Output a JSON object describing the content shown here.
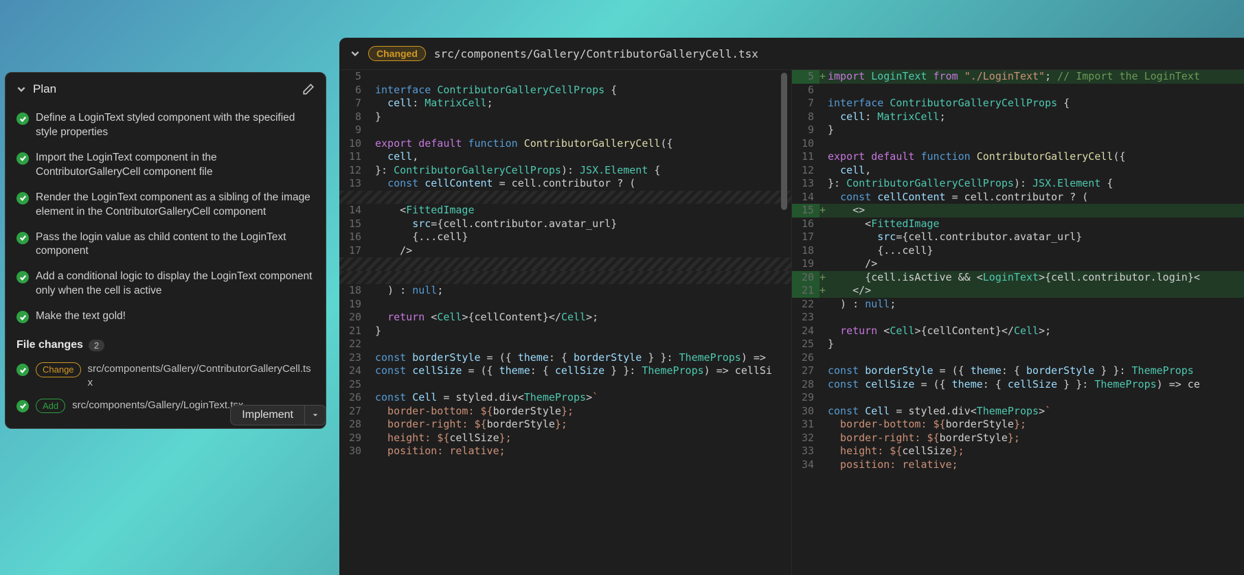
{
  "plan": {
    "title": "Plan",
    "items": [
      "Define a LoginText styled component with the specified style properties",
      "Import the LoginText component in the ContributorGalleryCell component file",
      "Render the LoginText component as a sibling of the image element in the ContributorGalleryCell component",
      "Pass the login value as child content to the LoginText component",
      "Add a conditional logic to display the LoginText component only when the cell is active",
      "Make the text gold!"
    ]
  },
  "file_changes": {
    "label": "File changes",
    "count": "2",
    "items": [
      {
        "badge": "Change",
        "path": "src/components/Gallery/ContributorGalleryCell.tsx"
      },
      {
        "badge": "Add",
        "path": "src/components/Gallery/LoginText.tsx"
      }
    ]
  },
  "implement_label": "Implement",
  "diff": {
    "badge": "Changed",
    "path": "src/components/Gallery/ContributorGalleryCell.tsx",
    "left": [
      {
        "n": "5",
        "t": "empty"
      },
      {
        "n": "6",
        "t": "code",
        "html": "<span class='kw2'>interface</span> <span class='type'>ContributorGalleryCellProps</span> {"
      },
      {
        "n": "7",
        "t": "code",
        "html": "  <span class='prop'>cell</span>: <span class='type'>MatrixCell</span>;"
      },
      {
        "n": "8",
        "t": "code",
        "html": "}"
      },
      {
        "n": "9",
        "t": "empty"
      },
      {
        "n": "10",
        "t": "code",
        "html": "<span class='kw'>export</span> <span class='kw'>default</span> <span class='kw2'>function</span> <span class='fn'>ContributorGalleryCell</span>({"
      },
      {
        "n": "11",
        "t": "code",
        "html": "  <span class='prop'>cell</span>,"
      },
      {
        "n": "12",
        "t": "code",
        "html": "}: <span class='type'>ContributorGalleryCellProps</span>): <span class='type'>JSX.Element</span> {"
      },
      {
        "n": "13",
        "t": "code",
        "html": "  <span class='kw2'>const</span> <span class='prop'>cellContent</span> = cell.contributor ? ("
      },
      {
        "n": "",
        "t": "hatched"
      },
      {
        "n": "14",
        "t": "code",
        "html": "    &lt;<span class='tag'>FittedImage</span>"
      },
      {
        "n": "15",
        "t": "code",
        "html": "      <span class='attr'>src</span>=<span class='op'>{</span>cell.contributor.avatar_url<span class='op'>}</span>"
      },
      {
        "n": "16",
        "t": "code",
        "html": "      <span class='op'>{</span>...cell<span class='op'>}</span>"
      },
      {
        "n": "17",
        "t": "code",
        "html": "    /&gt;"
      },
      {
        "n": "",
        "t": "hatched"
      },
      {
        "n": "",
        "t": "hatched"
      },
      {
        "n": "18",
        "t": "code",
        "html": "  ) : <span class='kw2'>null</span>;"
      },
      {
        "n": "19",
        "t": "empty"
      },
      {
        "n": "20",
        "t": "code",
        "html": "  <span class='kw'>return</span> &lt;<span class='tag'>Cell</span>&gt;<span class='op'>{</span>cellContent<span class='op'>}</span>&lt;/<span class='tag'>Cell</span>&gt;;"
      },
      {
        "n": "21",
        "t": "code",
        "html": "}"
      },
      {
        "n": "22",
        "t": "empty"
      },
      {
        "n": "23",
        "t": "code",
        "html": "<span class='kw2'>const</span> <span class='prop'>borderStyle</span> = ({ <span class='prop'>theme</span>: { <span class='prop'>borderStyle</span> } }: <span class='type'>ThemeProps</span>) =&gt;"
      },
      {
        "n": "24",
        "t": "code",
        "html": "<span class='kw2'>const</span> <span class='prop'>cellSize</span> = ({ <span class='prop'>theme</span>: { <span class='prop'>cellSize</span> } }: <span class='type'>ThemeProps</span>) =&gt; cellSi"
      },
      {
        "n": "25",
        "t": "empty"
      },
      {
        "n": "26",
        "t": "code",
        "html": "<span class='kw2'>const</span> <span class='prop'>Cell</span> = styled.div&lt;<span class='type'>ThemeProps</span>&gt;<span class='str'>`</span>"
      },
      {
        "n": "27",
        "t": "code",
        "html": "<span class='str'>  border-bottom: ${</span>borderStyle<span class='str'>};</span>"
      },
      {
        "n": "28",
        "t": "code",
        "html": "<span class='str'>  border-right: ${</span>borderStyle<span class='str'>};</span>"
      },
      {
        "n": "29",
        "t": "code",
        "html": "<span class='str'>  height: ${</span>cellSize<span class='str'>};</span>"
      },
      {
        "n": "30",
        "t": "code",
        "html": "<span class='str'>  position: relative;</span>"
      }
    ],
    "right": [
      {
        "n": "5",
        "t": "added",
        "m": "+",
        "html": "<span class='kw'>import</span> <span class='type'>LoginText</span> <span class='kw'>from</span> <span class='str'>\"./LoginText\"</span>; <span class='cmt'>// Import the LoginText</span>"
      },
      {
        "n": "6",
        "t": "empty"
      },
      {
        "n": "7",
        "t": "code",
        "html": "<span class='kw2'>interface</span> <span class='type'>ContributorGalleryCellProps</span> {"
      },
      {
        "n": "8",
        "t": "code",
        "html": "  <span class='prop'>cell</span>: <span class='type'>MatrixCell</span>;"
      },
      {
        "n": "9",
        "t": "code",
        "html": "}"
      },
      {
        "n": "10",
        "t": "empty"
      },
      {
        "n": "11",
        "t": "code",
        "html": "<span class='kw'>export</span> <span class='kw'>default</span> <span class='kw2'>function</span> <span class='fn'>ContributorGalleryCell</span>({"
      },
      {
        "n": "12",
        "t": "code",
        "html": "  <span class='prop'>cell</span>,"
      },
      {
        "n": "13",
        "t": "code",
        "html": "}: <span class='type'>ContributorGalleryCellProps</span>): <span class='type'>JSX.Element</span> {"
      },
      {
        "n": "14",
        "t": "code",
        "html": "  <span class='kw2'>const</span> <span class='prop'>cellContent</span> = cell.contributor ? ("
      },
      {
        "n": "15",
        "t": "added",
        "m": "+",
        "html": "    &lt;&gt;"
      },
      {
        "n": "16",
        "t": "code",
        "html": "      &lt;<span class='tag'>FittedImage</span>"
      },
      {
        "n": "17",
        "t": "code",
        "html": "        <span class='attr'>src</span>=<span class='op'>{</span>cell.contributor.avatar_url<span class='op'>}</span>"
      },
      {
        "n": "18",
        "t": "code",
        "html": "        <span class='op'>{</span>...cell<span class='op'>}</span>"
      },
      {
        "n": "19",
        "t": "code",
        "html": "      /&gt;"
      },
      {
        "n": "20",
        "t": "added",
        "m": "+",
        "html": "      <span class='op'>{</span>cell.isActive &amp;&amp; &lt;<span class='tag'>LoginText</span>&gt;<span class='op'>{</span>cell.contributor.login<span class='op'>}</span>&lt;"
      },
      {
        "n": "21",
        "t": "added",
        "m": "+",
        "html": "    &lt;/&gt;"
      },
      {
        "n": "22",
        "t": "code",
        "html": "  ) : <span class='kw2'>null</span>;"
      },
      {
        "n": "23",
        "t": "empty"
      },
      {
        "n": "24",
        "t": "code",
        "html": "  <span class='kw'>return</span> &lt;<span class='tag'>Cell</span>&gt;<span class='op'>{</span>cellContent<span class='op'>}</span>&lt;/<span class='tag'>Cell</span>&gt;;"
      },
      {
        "n": "25",
        "t": "code",
        "html": "}"
      },
      {
        "n": "26",
        "t": "empty"
      },
      {
        "n": "27",
        "t": "code",
        "html": "<span class='kw2'>const</span> <span class='prop'>borderStyle</span> = ({ <span class='prop'>theme</span>: { <span class='prop'>borderStyle</span> } }: <span class='type'>ThemeProps</span>"
      },
      {
        "n": "28",
        "t": "code",
        "html": "<span class='kw2'>const</span> <span class='prop'>cellSize</span> = ({ <span class='prop'>theme</span>: { <span class='prop'>cellSize</span> } }: <span class='type'>ThemeProps</span>) =&gt; ce"
      },
      {
        "n": "29",
        "t": "empty"
      },
      {
        "n": "30",
        "t": "code",
        "html": "<span class='kw2'>const</span> <span class='prop'>Cell</span> = styled.div&lt;<span class='type'>ThemeProps</span>&gt;<span class='str'>`</span>"
      },
      {
        "n": "31",
        "t": "code",
        "html": "<span class='str'>  border-bottom: ${</span>borderStyle<span class='str'>};</span>"
      },
      {
        "n": "32",
        "t": "code",
        "html": "<span class='str'>  border-right: ${</span>borderStyle<span class='str'>};</span>"
      },
      {
        "n": "33",
        "t": "code",
        "html": "<span class='str'>  height: ${</span>cellSize<span class='str'>};</span>"
      },
      {
        "n": "34",
        "t": "code",
        "html": "<span class='str'>  position: relative;</span>"
      }
    ]
  }
}
